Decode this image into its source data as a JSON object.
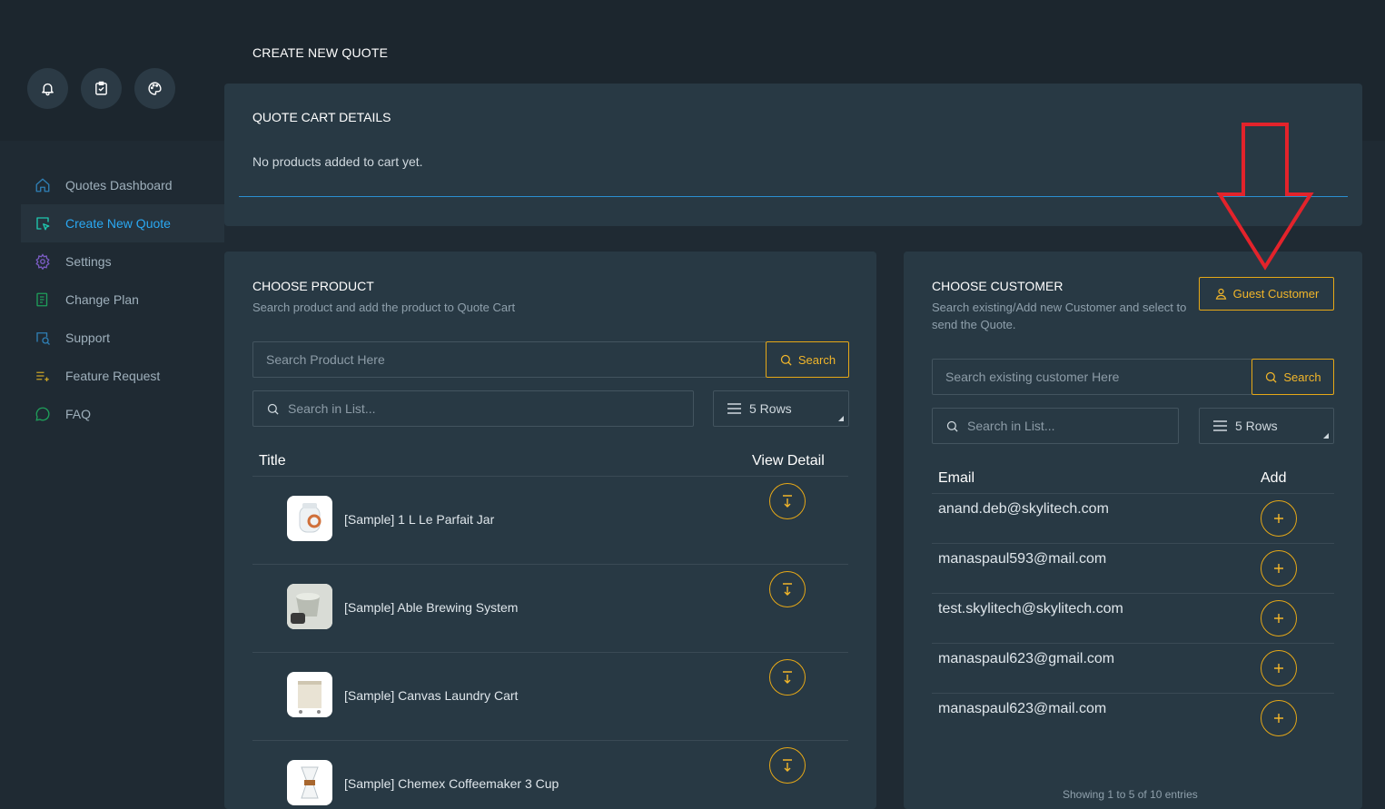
{
  "page": {
    "title": "CREATE NEW QUOTE"
  },
  "top_icons": [
    "bell-icon",
    "clipboard-check-icon",
    "palette-icon"
  ],
  "sidebar": {
    "items": [
      {
        "label": "Quotes Dashboard",
        "icon": "home-icon",
        "active": false
      },
      {
        "label": "Create New Quote",
        "icon": "cursor-window-icon",
        "active": true
      },
      {
        "label": "Settings",
        "icon": "gear-icon",
        "active": false
      },
      {
        "label": "Change Plan",
        "icon": "plan-icon",
        "active": false
      },
      {
        "label": "Support",
        "icon": "chat-search-icon",
        "active": false
      },
      {
        "label": "Feature Request",
        "icon": "list-add-icon",
        "active": false
      },
      {
        "label": "FAQ",
        "icon": "speech-bubble-icon",
        "active": false
      }
    ]
  },
  "cart": {
    "title": "QUOTE CART DETAILS",
    "empty_text": "No products added to cart yet."
  },
  "product": {
    "title": "CHOOSE PRODUCT",
    "subtitle": "Search product and add the product to Quote Cart",
    "search_placeholder": "Search Product Here",
    "search_button": "Search",
    "list_search_placeholder": "Search in List...",
    "rows_label": "5 Rows",
    "columns": [
      "Title",
      "View Detail"
    ],
    "items": [
      {
        "title": "[Sample] 1 L Le Parfait Jar"
      },
      {
        "title": "[Sample] Able Brewing System"
      },
      {
        "title": "[Sample] Canvas Laundry Cart"
      },
      {
        "title": "[Sample] Chemex Coffeemaker 3 Cup"
      }
    ]
  },
  "customer": {
    "title": "CHOOSE CUSTOMER",
    "subtitle_line1": "Search existing/Add new Customer and select to",
    "subtitle_line2": "send the Quote.",
    "guest_button": "Guest Customer",
    "search_placeholder": "Search existing customer Here",
    "search_button": "Search",
    "list_search_placeholder": "Search in List...",
    "rows_label": "5 Rows",
    "columns": [
      "Email",
      "Add"
    ],
    "emails": [
      "anand.deb@skylitech.com",
      "manaspaul593@mail.com",
      "test.skylitech@skylitech.com",
      "manaspaul623@gmail.com",
      "manaspaul623@mail.com"
    ],
    "footer": "Showing 1 to 5 of 10 entries"
  },
  "colors": {
    "accent": "#f2b62a",
    "active_link": "#2aa8f2",
    "card_bg": "#283944",
    "page_bg": "#1f2a33",
    "annotation_arrow": "#e3232b"
  }
}
